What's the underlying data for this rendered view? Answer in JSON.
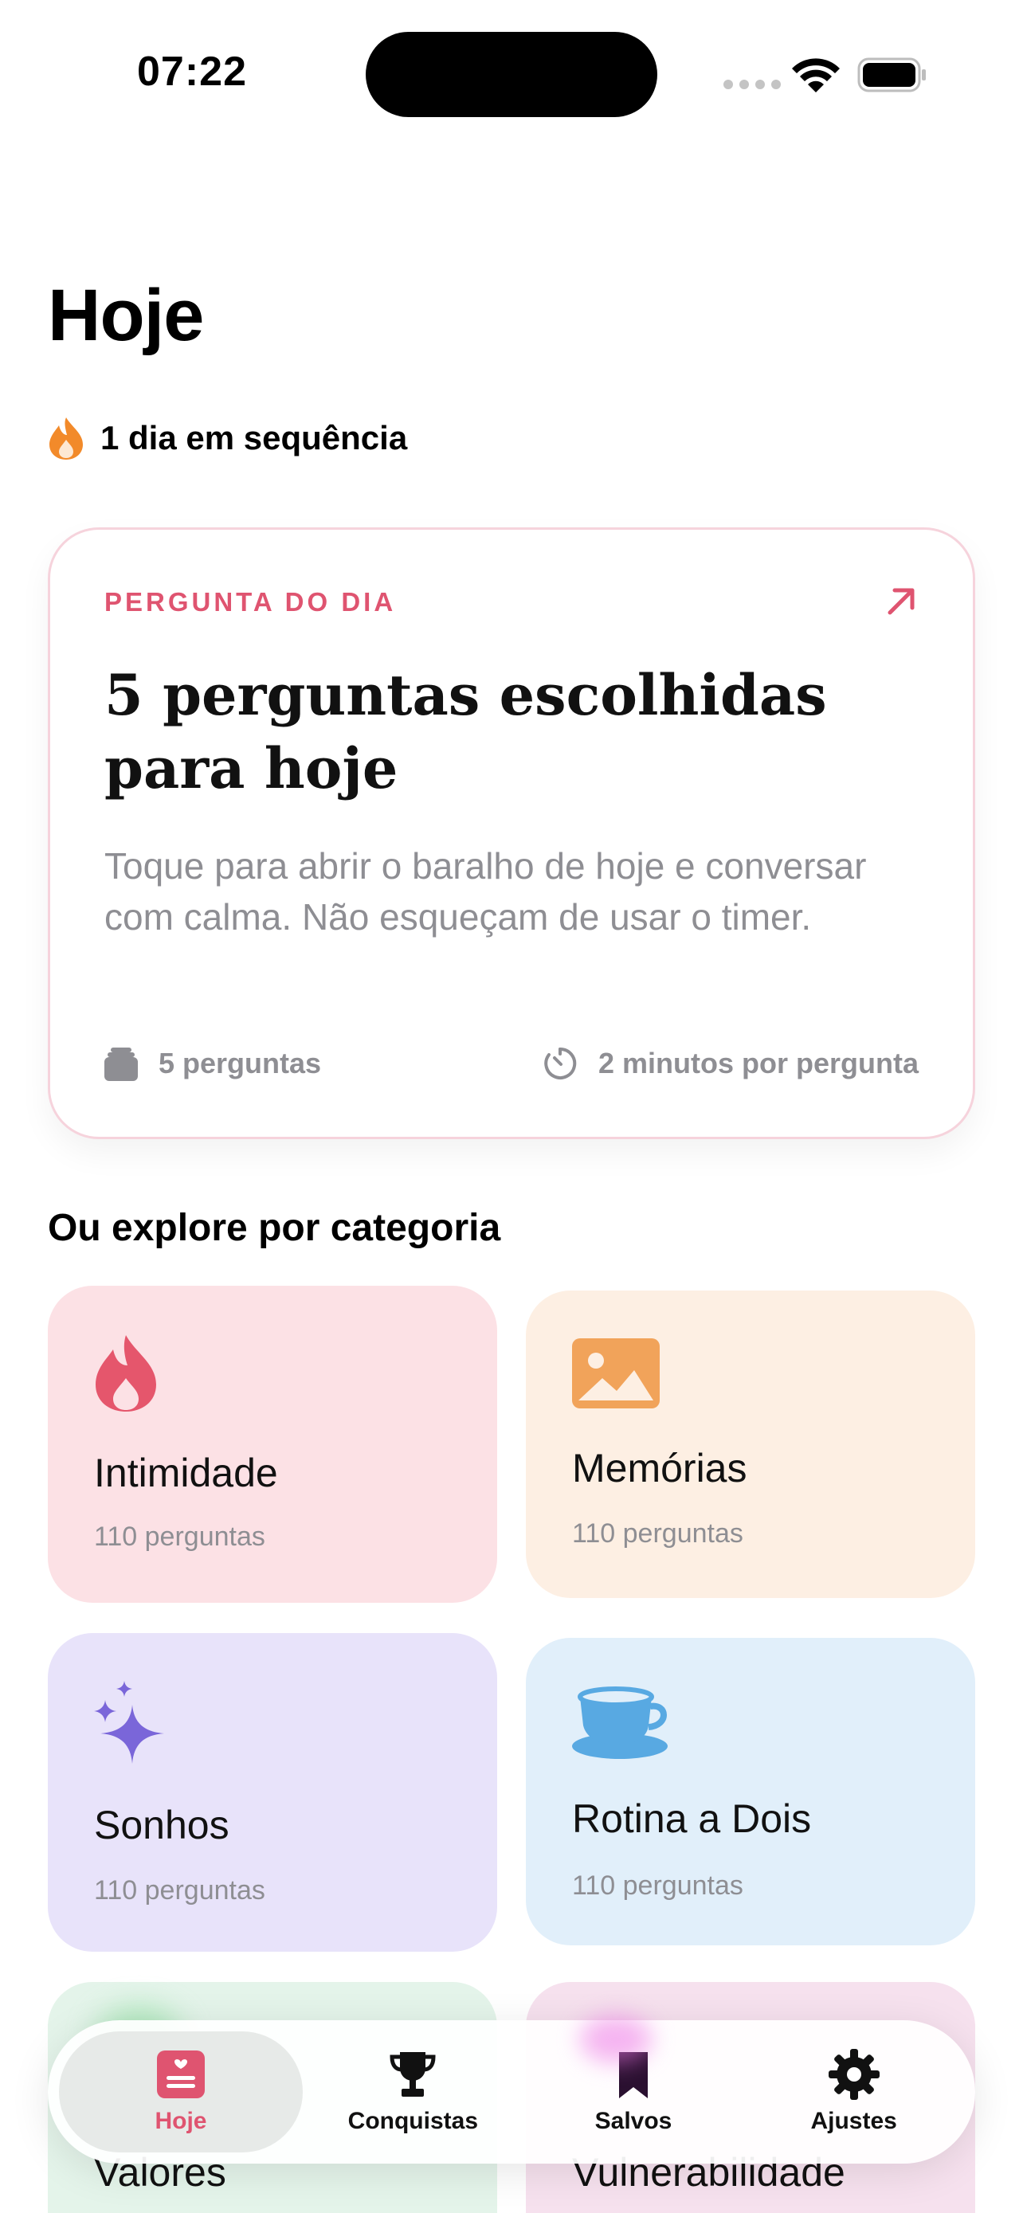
{
  "status_bar": {
    "time": "07:22"
  },
  "header": {
    "title": "Hoje",
    "streak_text": "1 dia em sequência"
  },
  "daily_card": {
    "eyebrow": "PERGUNTA DO DIA",
    "title": "5 perguntas escolhidas para hoje",
    "description": "Toque para abrir o baralho de hoje e conversar com calma. Não esqueçam de usar o timer.",
    "question_count": "5 perguntas",
    "timer_text": "2 minutos por pergunta"
  },
  "categories": {
    "section_title": "Ou explore por categoria",
    "items": [
      {
        "name": "Intimidade",
        "count": "110 perguntas",
        "icon": "flame-icon",
        "color": "#fce1e5",
        "accent": "#e5566c"
      },
      {
        "name": "Memórias",
        "count": "110 perguntas",
        "icon": "photo-icon",
        "color": "#fdefe3",
        "accent": "#f1a35a"
      },
      {
        "name": "Sonhos",
        "count": "110 perguntas",
        "icon": "sparkles-icon",
        "color": "#e8e3fa",
        "accent": "#7a66d9"
      },
      {
        "name": "Rotina a Dois",
        "count": "110 perguntas",
        "icon": "cup-icon",
        "color": "#e1effa",
        "accent": "#58a9e2"
      },
      {
        "name": "Valores",
        "icon": "card-icon",
        "color": "#e4f4ea"
      },
      {
        "name": "Vulnerabilidade",
        "icon": "card-icon",
        "color": "#f6e1ee"
      }
    ]
  },
  "tab_bar": {
    "tabs": [
      {
        "label": "Hoje",
        "icon": "today-card-icon",
        "active": true
      },
      {
        "label": "Conquistas",
        "icon": "trophy-icon",
        "active": false
      },
      {
        "label": "Salvos",
        "icon": "bookmark-icon",
        "active": false
      },
      {
        "label": "Ajustes",
        "icon": "gear-icon",
        "active": false
      }
    ]
  },
  "colors": {
    "accent": "#df5470",
    "secondary_text": "#8e8e93",
    "streak": "#f28a2a"
  }
}
